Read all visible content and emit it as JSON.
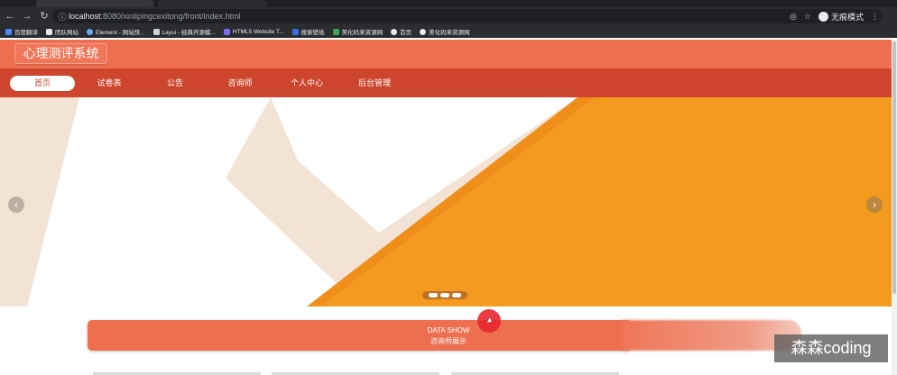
{
  "browser": {
    "url_host": "localhost",
    "url_path": ":8080/xinlipingcexitong/front/index.html",
    "incognito_label": "无痕模式",
    "bookmarks": [
      {
        "label": "百度翻译",
        "icon": "translate-icon"
      },
      {
        "label": "团队网站",
        "icon": "flag-icon"
      },
      {
        "label": "Element - 网站快...",
        "icon": "element-icon"
      },
      {
        "label": "Layui - 经典开源模...",
        "icon": "layui-icon"
      },
      {
        "label": "HTML5 Website T...",
        "icon": "html5-icon"
      },
      {
        "label": "搜索壁纸",
        "icon": "wallpaper-icon"
      },
      {
        "label": "美化码来资源网",
        "icon": "bookmark-icon"
      },
      {
        "label": "首页",
        "icon": "globe-icon"
      },
      {
        "label": "美化码来资源网",
        "icon": "globe-icon"
      }
    ]
  },
  "site": {
    "logo": "心理测评系统",
    "nav": [
      "首页",
      "试卷表",
      "公告",
      "咨询师",
      "个人中心",
      "后台管理"
    ],
    "active_nav": "首页"
  },
  "banner": {
    "prev_label": "‹",
    "next_label": "›",
    "slide_count": 3,
    "active_slide": 1
  },
  "section": {
    "title": "DATA SHOW",
    "subtitle": "咨询师展示"
  },
  "watermark": "森森coding",
  "colors": {
    "header": "#ee6f50",
    "nav": "#cc452c",
    "banner_orange": "#f39a1f",
    "banner_cream": "#f3e3d5"
  }
}
